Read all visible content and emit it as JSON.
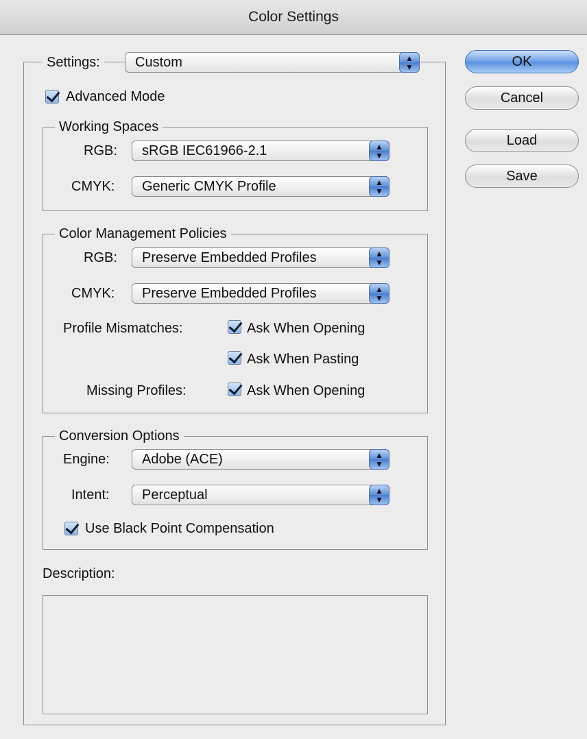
{
  "window": {
    "title": "Color Settings"
  },
  "settings": {
    "label": "Settings:",
    "value": "Custom"
  },
  "advanced_mode": {
    "label": "Advanced Mode",
    "checked": true
  },
  "working_spaces": {
    "title": "Working Spaces",
    "rgb_label": "RGB:",
    "rgb_value": "sRGB IEC61966-2.1",
    "cmyk_label": "CMYK:",
    "cmyk_value": "Generic CMYK Profile"
  },
  "policies": {
    "title": "Color Management Policies",
    "rgb_label": "RGB:",
    "rgb_value": "Preserve Embedded Profiles",
    "cmyk_label": "CMYK:",
    "cmyk_value": "Preserve Embedded Profiles",
    "mismatch_label": "Profile Mismatches:",
    "ask_opening": "Ask When Opening",
    "ask_pasting": "Ask When Pasting",
    "missing_label": "Missing Profiles:",
    "missing_ask_opening": "Ask When Opening"
  },
  "conversion": {
    "title": "Conversion Options",
    "engine_label": "Engine:",
    "engine_value": "Adobe (ACE)",
    "intent_label": "Intent:",
    "intent_value": "Perceptual",
    "bpc_label": "Use Black Point Compensation"
  },
  "description": {
    "label": "Description:"
  },
  "buttons": {
    "ok": "OK",
    "cancel": "Cancel",
    "load": "Load",
    "save": "Save"
  },
  "colors": {
    "accent": "#5b8fdc",
    "window_bg": "#ececec"
  }
}
